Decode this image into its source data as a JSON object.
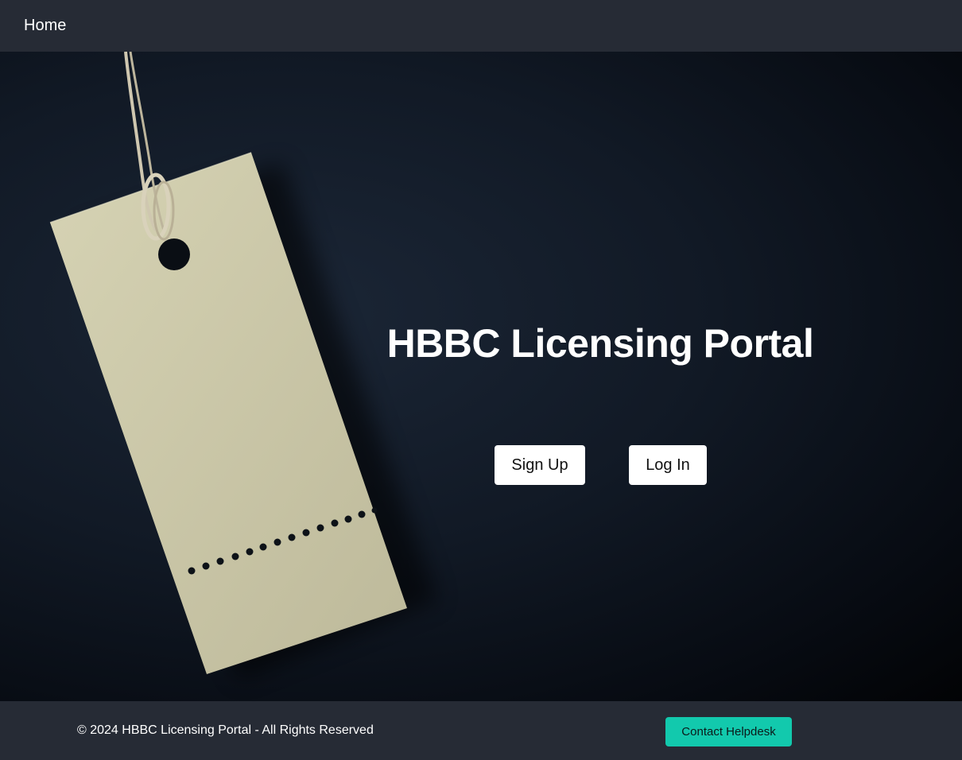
{
  "nav": {
    "home_label": "Home"
  },
  "hero": {
    "title": "HBBC Licensing Portal",
    "signup_label": "Sign Up",
    "login_label": "Log In",
    "background_image": "price-tag-on-dark-background"
  },
  "footer": {
    "copyright": "© 2024 HBBC Licensing Portal - All Rights Reserved",
    "helpdesk_label": "Contact Helpdesk"
  },
  "colors": {
    "nav_bg": "#262b35",
    "footer_bg": "#262b35",
    "accent": "#12c9ad",
    "button_bg": "#ffffff"
  }
}
